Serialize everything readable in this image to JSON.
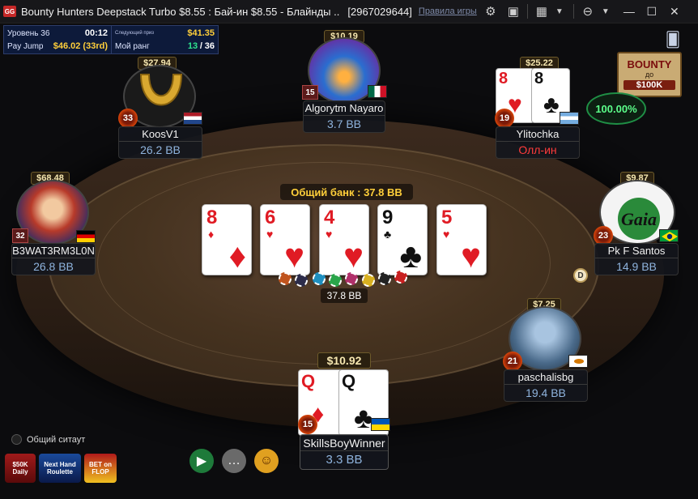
{
  "window": {
    "title": "Bounty Hunters Deepstack Turbo $8.55 : Бай-ин $8.55 - Блайнды ..",
    "table_id": "[2967029644]",
    "rules_link": "Правила игры",
    "logo": "GG"
  },
  "stats": {
    "level_label": "Уровень 36",
    "level_timer": "00:12",
    "next_prize_label": "Следующий приз",
    "next_prize_value": "$41.35",
    "payjump_label": "Pay Jump",
    "payjump_value": "$46.02 (33rd)",
    "rank_label": "Мой ранг",
    "rank_current": "13",
    "rank_separator": "/",
    "rank_total": "36"
  },
  "pot": {
    "label": "Общий банк : 37.8 BB",
    "amount": "37.8 BB"
  },
  "board": [
    {
      "rank": "8",
      "suit": "♦",
      "color": "red"
    },
    {
      "rank": "6",
      "suit": "♥",
      "color": "red"
    },
    {
      "rank": "4",
      "suit": "♥",
      "color": "red"
    },
    {
      "rank": "9",
      "suit": "♣",
      "color": "black"
    },
    {
      "rank": "5",
      "suit": "♥",
      "color": "red"
    }
  ],
  "players": {
    "koosv1": {
      "name": "KoosV1",
      "stack": "26.2 BB",
      "bounty": "$27.94",
      "level": "33",
      "flag": "NL"
    },
    "algorytm": {
      "name": "Algorytm Nayaro",
      "stack": "3.7 BB",
      "bounty": "$10.19",
      "level": "15",
      "flag": "MX"
    },
    "ylitochka": {
      "name": "Ylitochka",
      "stack": "Олл-ин",
      "bounty": "$25.22",
      "level": "19",
      "flag": "AR",
      "cards": [
        {
          "rank": "8",
          "suit": "♥",
          "color": "red"
        },
        {
          "rank": "8",
          "suit": "♣",
          "color": "black"
        }
      ]
    },
    "b3wat": {
      "name": "B3WAT3RM3L0N",
      "stack": "26.8 BB",
      "bounty": "$68.48",
      "level": "32",
      "flag": "DE"
    },
    "pkf": {
      "name": "Pk F Santos",
      "stack": "14.9 BB",
      "bounty": "$9.87",
      "level": "23",
      "flag": "BR"
    },
    "paschal": {
      "name": "paschalisbg",
      "stack": "19.4 BB",
      "bounty": "$7.25",
      "level": "21",
      "flag": "CY"
    },
    "hero": {
      "name": "SkillsBoyWinner",
      "stack": "3.3 BB",
      "bounty": "$10.92",
      "level": "15",
      "flag": "UA",
      "cards": [
        {
          "rank": "Q",
          "suit": "♦",
          "color": "red"
        },
        {
          "rank": "Q",
          "suit": "♣",
          "color": "black"
        }
      ]
    }
  },
  "equity": "100.00%",
  "bounty_promo": {
    "line1": "BOUNTY",
    "line2": "до",
    "line3": "$100K"
  },
  "dealer_button": "D",
  "controls": {
    "sitout_label": "Общий ситаут",
    "promos": [
      "$50K Daily",
      "Next Hand Roulette",
      "BET on FLOP"
    ],
    "icons": [
      "video-replay-icon",
      "chat-icon",
      "emoji-icon"
    ]
  },
  "colors": {
    "accent_yellow": "#ffcf3a",
    "stack_blue": "#8fb4de",
    "allin_red": "#ff3b3b",
    "equity_green": "#5cff8a"
  }
}
